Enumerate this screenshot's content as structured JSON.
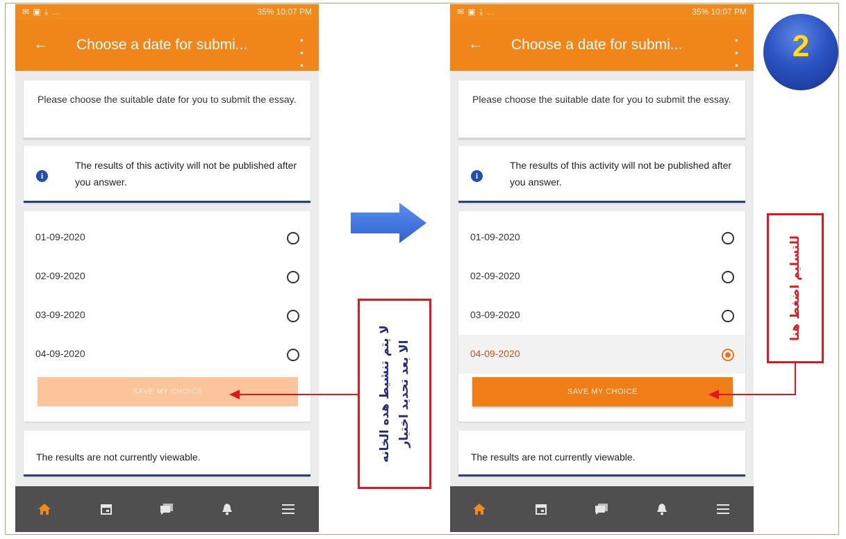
{
  "status_bar": {
    "left_icons": "✉ ▣ ⤓ …",
    "right_text": "35% 10:07 PM"
  },
  "app_bar": {
    "title": "Choose a date for submi...",
    "back_icon": "arrow-left-icon",
    "menu_icon": "more-vertical-icon"
  },
  "intro_text": "Please choose the suitable date for you to submit the essay.",
  "info_text": "The results of this activity will not be published after you answer.",
  "options": [
    "01-09-2020",
    "02-09-2020",
    "03-09-2020",
    "04-09-2020"
  ],
  "selected_option_right": "04-09-2020",
  "save_button_label": "SAVE MY CHOICE",
  "results_text": "The results are not currently viewable.",
  "bottom_nav": [
    "home-icon",
    "calendar-icon",
    "messages-icon",
    "bell-icon",
    "menu-icon"
  ],
  "colors": {
    "accent": "#f0861a",
    "button_disabled": "#fbc49a",
    "button_enabled": "#f07d15",
    "nav_bg": "#4f4f4f",
    "annotation_red": "#e0181e",
    "annotation_text_dark": "#2a2a7a",
    "arrow_blue": "#3a6fd8"
  },
  "annotations": {
    "left_note": "لا يتم تنشيط هده الخانه\nالا بعد تحديد اختيار",
    "right_note": "للتسليم اضغط هنا",
    "step_badge": "2"
  }
}
